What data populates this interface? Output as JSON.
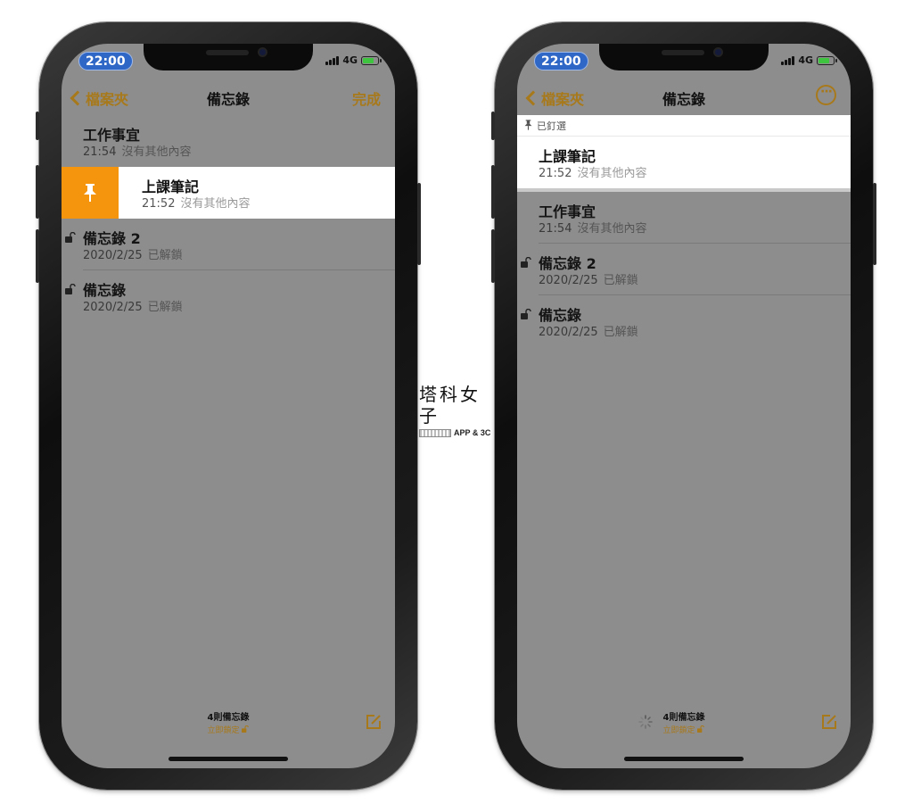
{
  "status": {
    "time": "22:00",
    "network": "4G"
  },
  "nav": {
    "back": "檔案夾",
    "title": "備忘錄",
    "done": "完成"
  },
  "left_notes": [
    {
      "title": "工作事宜",
      "time": "21:54",
      "preview": "沒有其他內容"
    },
    {
      "title": "上課筆記",
      "time": "21:52",
      "preview": "沒有其他內容"
    },
    {
      "title": "備忘錄 2",
      "time": "2020/2/25",
      "preview": "已解鎖"
    },
    {
      "title": "備忘錄",
      "time": "2020/2/25",
      "preview": "已解鎖"
    }
  ],
  "right_pinned_label": "已釘選",
  "right_notes": [
    {
      "title": "上課筆記",
      "time": "21:52",
      "preview": "沒有其他內容"
    },
    {
      "title": "工作事宜",
      "time": "21:54",
      "preview": "沒有其他內容"
    },
    {
      "title": "備忘錄 2",
      "time": "2020/2/25",
      "preview": "已解鎖"
    },
    {
      "title": "備忘錄",
      "time": "2020/2/25",
      "preview": "已解鎖"
    }
  ],
  "footer": {
    "count": "4則備忘錄",
    "lock_now": "立即鎖定"
  },
  "watermark": {
    "title": "塔科女子",
    "tag": "APP & 3C"
  },
  "icons": {
    "pin": "pushpin-icon",
    "lock": "unlocked-padlock-icon",
    "compose": "compose-icon",
    "more": "ellipsis-circle-icon",
    "back": "chevron-left-icon"
  },
  "colors": {
    "accent": "#a8791b",
    "pin_action": "#f5950e",
    "dimmed_background": "#8d8d8d",
    "time_pill": "#2f67c7"
  }
}
